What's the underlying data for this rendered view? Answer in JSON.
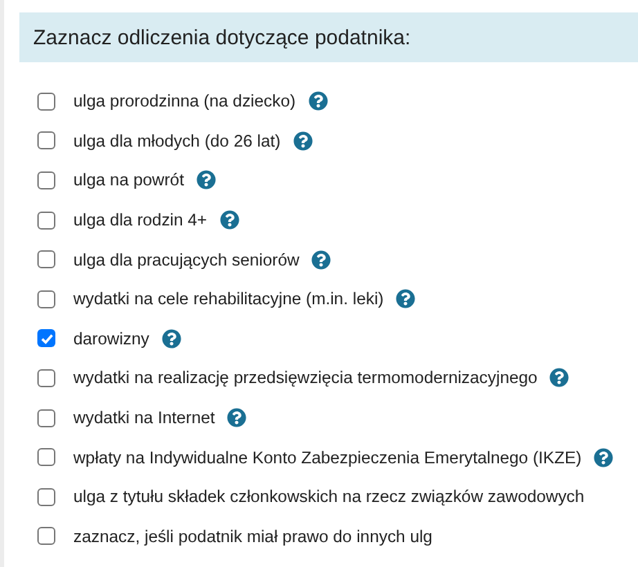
{
  "header": {
    "title": "Zaznacz odliczenia dotyczące podatnika:"
  },
  "options": [
    {
      "label": "ulga prorodzinna (na dziecko)",
      "checked": false,
      "help": true
    },
    {
      "label": "ulga dla młodych (do 26 lat)",
      "checked": false,
      "help": true
    },
    {
      "label": "ulga na powrót",
      "checked": false,
      "help": true
    },
    {
      "label": "ulga dla rodzin 4+",
      "checked": false,
      "help": true
    },
    {
      "label": "ulga dla pracujących seniorów",
      "checked": false,
      "help": true
    },
    {
      "label": "wydatki na cele rehabilitacyjne (m.in. leki)",
      "checked": false,
      "help": true
    },
    {
      "label": "darowizny",
      "checked": true,
      "help": true
    },
    {
      "label": "wydatki na realizację przedsięwzięcia termomodernizacyjnego",
      "checked": false,
      "help": true
    },
    {
      "label": "wydatki na Internet",
      "checked": false,
      "help": true
    },
    {
      "label": "wpłaty na Indywidualne Konto Zabezpieczenia Emerytalnego (IKZE)",
      "checked": false,
      "help": true
    },
    {
      "label": "ulga z tytułu składek członkowskich na rzecz związków zawodowych",
      "checked": false,
      "help": false
    },
    {
      "label": "zaznacz, jeśli podatnik miał prawo do innych ulg",
      "checked": false,
      "help": false
    }
  ]
}
